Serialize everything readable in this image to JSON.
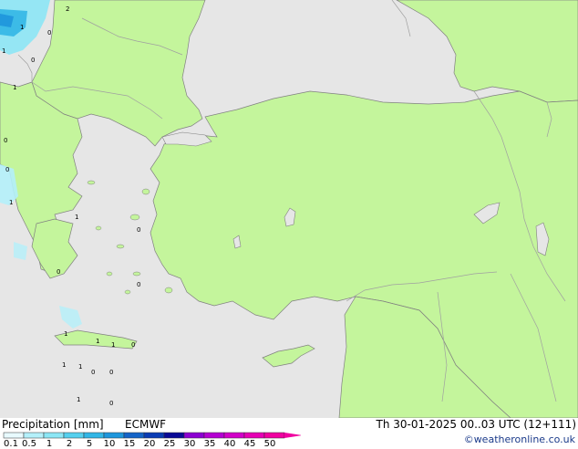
{
  "map": {
    "sea_color": "#e6e6e6",
    "land_color": "#c4f59c",
    "border_color": "#a0a0a0",
    "coast_color": "#808080",
    "precip_labels": [
      "2",
      "1",
      "0",
      "1",
      "0",
      "1",
      "0",
      "1",
      "1",
      "0",
      "1",
      "1",
      "1",
      "0",
      "1",
      "1",
      "1",
      "0",
      "0",
      "0",
      "0",
      "0",
      "0"
    ]
  },
  "legend": {
    "title": "Precipitation [mm]",
    "model": "ECMWF",
    "valid": "Th 30-01-2025 00..03 UTC (12+111)",
    "credit": "©weatheronline.co.uk",
    "ticks": [
      "0.1",
      "0.5",
      "1",
      "2",
      "5",
      "10",
      "15",
      "20",
      "25",
      "30",
      "35",
      "40",
      "45",
      "50"
    ],
    "colors": [
      "#e8faff",
      "#b4f0fa",
      "#8ce6f5",
      "#55d0ee",
      "#32b6e6",
      "#1e96dc",
      "#1464c8",
      "#0a3cb4",
      "#0a0a96",
      "#8c00d2",
      "#b400d2",
      "#d200c8",
      "#e600b4",
      "#f000a0"
    ]
  }
}
